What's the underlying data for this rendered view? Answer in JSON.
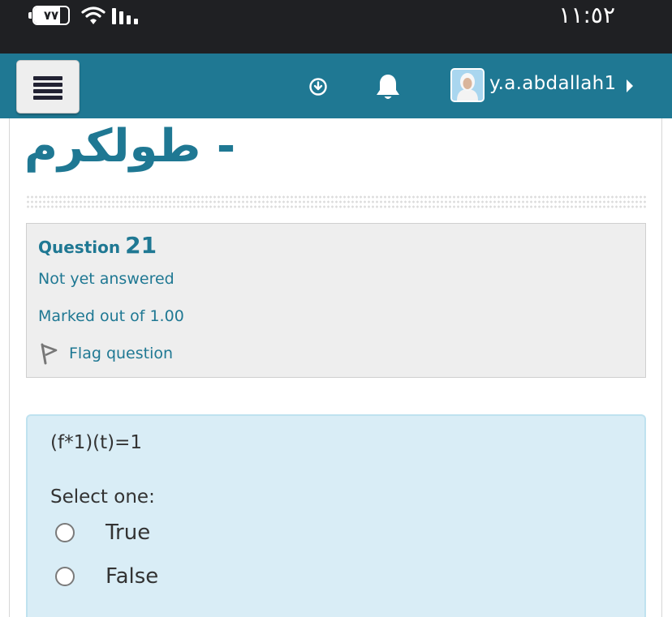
{
  "status_bar": {
    "battery_level": "٧٧",
    "time": "١١:٥٢"
  },
  "navbar": {
    "username": "y.a.abdallah1"
  },
  "page": {
    "course_title": "- طولكرم"
  },
  "question_info": {
    "label": "Question",
    "number": "21",
    "state": "Not yet answered",
    "grade": "Marked out of 1.00",
    "flag_label": "Flag question"
  },
  "question": {
    "text": "(f*1)(t)=1",
    "prompt": "Select one:",
    "options": [
      {
        "label": "True"
      },
      {
        "label": "False"
      }
    ]
  },
  "colors": {
    "brand": "#1f7893",
    "status_bar": "#1f2023",
    "question_bg": "#d9edf6",
    "info_bg": "#eeeeee"
  },
  "icons": {
    "menu": "hamburger-menu-icon",
    "download": "download-circle-icon",
    "notifications": "bell-icon",
    "flag": "flag-outline-icon",
    "user_menu": "caret-right-icon"
  }
}
